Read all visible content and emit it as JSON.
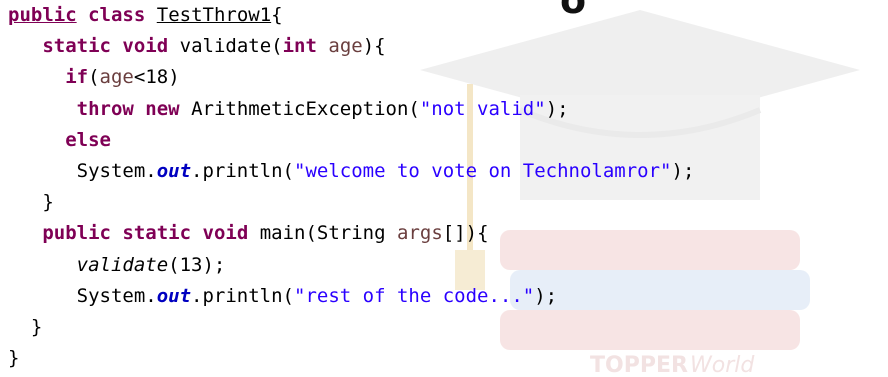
{
  "header_clip": "o",
  "colors": {
    "keyword": "#7f0055",
    "variable": "#6a3e3e",
    "string": "#2a00ff",
    "static_field": "#0000c0",
    "plain": "#000000"
  },
  "code": {
    "l1": {
      "kw1": "public",
      "kw2": "class",
      "classname": "TestThrow1",
      "brace": "{"
    },
    "l2": {
      "kw1": "static",
      "kw2": "void",
      "method": "validate(",
      "kw3": "int",
      "param": "age",
      "close": "){"
    },
    "l3": {
      "kw": "if",
      "open": "(",
      "var": "age",
      "rest": "<18)"
    },
    "l4": {
      "kw1": "throw",
      "kw2": "new",
      "ctor": "ArithmeticException(",
      "str": "\"not valid\"",
      "close": ");"
    },
    "l5": {
      "kw": "else"
    },
    "l6": {
      "obj": "System.",
      "field": "out",
      "call": ".println(",
      "str": "\"welcome to vote on Technolamror\"",
      "close": ");"
    },
    "l7": {
      "brace": "}"
    },
    "l8": {
      "kw1": "public",
      "kw2": "static",
      "kw3": "void",
      "method": "main(String ",
      "var": "args",
      "close": "[]){"
    },
    "l9": {
      "call": "validate",
      "args": "(13);"
    },
    "l10": {
      "obj": "System.",
      "field": "out",
      "call": ".println(",
      "str": "\"rest of the code...\"",
      "close": ");"
    },
    "l11": {
      "brace": "}"
    },
    "l12": {
      "brace": "}"
    }
  }
}
